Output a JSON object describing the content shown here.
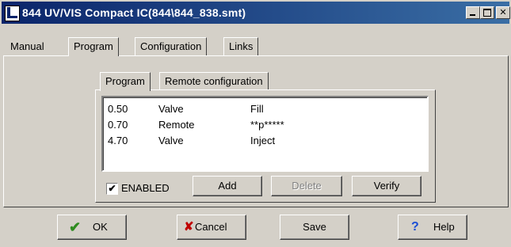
{
  "window": {
    "title": "844 UV/VIS Compact IC(844\\844_838.smt)",
    "controls": [
      "minimize",
      "maximize",
      "close"
    ]
  },
  "main_tabs": [
    {
      "label": "Manual"
    },
    {
      "label": "Program",
      "active": true
    },
    {
      "label": "Configuration"
    },
    {
      "label": "Links"
    }
  ],
  "sub_tabs": [
    {
      "label": "Program",
      "active": true
    },
    {
      "label": "Remote configuration"
    }
  ],
  "program_list": [
    {
      "time": "0.50",
      "action": "Valve",
      "param": "Fill"
    },
    {
      "time": "0.70",
      "action": "Remote",
      "param": "**p*****"
    },
    {
      "time": "4.70",
      "action": "Valve",
      "param": "Inject"
    }
  ],
  "enabled": {
    "label": "ENABLED",
    "checked": true,
    "mark": "✔"
  },
  "list_buttons": {
    "add": "Add",
    "delete": "Delete",
    "verify": "Verify"
  },
  "bottom_buttons": {
    "ok": {
      "label": "OK",
      "icon": "checkmark-icon",
      "glyph": "✔"
    },
    "cancel": {
      "label": "Cancel",
      "icon": "x-icon",
      "glyph": "✘"
    },
    "save": {
      "label": "Save"
    },
    "help": {
      "label": "Help",
      "icon": "question-icon",
      "glyph": "?"
    }
  }
}
